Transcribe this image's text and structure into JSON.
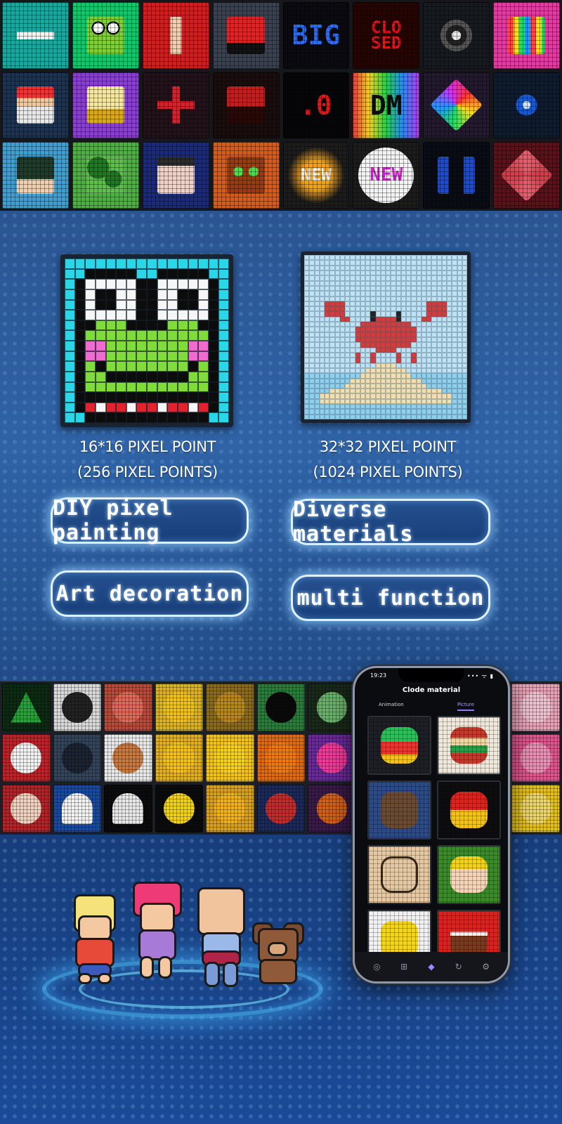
{
  "top_tiles": [
    {
      "icon": "airplane-icon",
      "bg": "#1aa7a0"
    },
    {
      "icon": "frog-face-icon",
      "bg": "#12c76a"
    },
    {
      "icon": "red-figure-icon",
      "bg": "#d01f1f"
    },
    {
      "icon": "red-bus-icon",
      "bg": "#3a4150"
    },
    {
      "icon": "big-text-icon",
      "bg": "#0a0a10",
      "text": "BIG",
      "color": "#2f6df0"
    },
    {
      "icon": "closed-text-icon",
      "bg": "#260404",
      "text": "CLO SED",
      "color": "#e0191c"
    },
    {
      "icon": "record-disc-icon",
      "bg": "#171a20"
    },
    {
      "icon": "rainbow-pattern-icon",
      "bg": "#e43aa3"
    },
    {
      "icon": "cashier-icon",
      "bg": "#1d3352"
    },
    {
      "icon": "trophy-cup-icon",
      "bg": "#8a3fd0"
    },
    {
      "icon": "red-cross-pattern-icon",
      "bg": "#23121a"
    },
    {
      "icon": "game-console-icon",
      "bg": "#1a0d0d"
    },
    {
      "icon": "zero-text-icon",
      "bg": "#060608",
      "text": ".0",
      "color": "#e01a1a"
    },
    {
      "icon": "dm-text-icon",
      "bg": "#1d1d22",
      "text": "DM",
      "color": "#0d0d0d"
    },
    {
      "icon": "rainbow-diamond-icon",
      "bg": "#241a2f"
    },
    {
      "icon": "blue-square-pattern-icon",
      "bg": "#0f1b2e"
    },
    {
      "icon": "classroom-icon",
      "bg": "#3e9fd3"
    },
    {
      "icon": "forest-icon",
      "bg": "#4cb140"
    },
    {
      "icon": "face-portrait-icon",
      "bg": "#1b2a7a"
    },
    {
      "icon": "robot-face-icon",
      "bg": "#d75b1a"
    },
    {
      "icon": "new-burst-icon",
      "bg": "#1c1c1c",
      "text": "NEW",
      "color": "#f3f3f3"
    },
    {
      "icon": "new-circle-icon",
      "bg": "#1c1c1c",
      "text": "NEW",
      "color": "#d21ecf"
    },
    {
      "icon": "blue-shapes-icon",
      "bg": "#090c14"
    },
    {
      "icon": "red-diamond-icon",
      "bg": "#5c1018"
    }
  ],
  "specs": {
    "small_line1": "16*16 PIXEL POINT",
    "small_line2": "(256 PIXEL POINTS)",
    "large_line1": "32*32 PIXEL POINT",
    "large_line2": "(1024 PIXEL POINTS)"
  },
  "features": {
    "diy": "DIY pixel painting",
    "diverse": "Diverse materials",
    "art": "Art decoration",
    "multi": "multi function"
  },
  "strip_tiles": [
    {
      "icon": "christmas-tree-icon",
      "bg": "#0d2a12"
    },
    {
      "icon": "cat-icon",
      "bg": "#d9d9d9"
    },
    {
      "icon": "red-monster-icon",
      "bg": "#b84a3c"
    },
    {
      "icon": "smiley-face-icon",
      "bg": "#d9b325"
    },
    {
      "icon": "cookie-face-icon",
      "bg": "#8a6b1e"
    },
    {
      "icon": "green-cat-face-icon",
      "bg": "#2b7c3a"
    },
    {
      "icon": "skull-icon",
      "bg": "#1a2a1a"
    },
    {
      "icon": "santa-icon",
      "bg": "#c0222a"
    },
    {
      "icon": "dark-figure-icon",
      "bg": "#34445a"
    },
    {
      "icon": "boy-icon",
      "bg": "#e9e9e9"
    },
    {
      "icon": "heart-eyes-emoji-icon",
      "bg": "#e0b020"
    },
    {
      "icon": "laughing-emoji-icon",
      "bg": "#f2c319"
    },
    {
      "icon": "pumpkin-icon",
      "bg": "#e06a10"
    },
    {
      "icon": "rainbow-skull-icon",
      "bg": "#6a2a9a"
    },
    {
      "icon": "santa-claus-icon",
      "bg": "#b3242a"
    },
    {
      "icon": "ghost-icon",
      "bg": "#1a4aa0"
    },
    {
      "icon": "small-ghost-icon",
      "bg": "#0b0b0d"
    },
    {
      "icon": "tiny-smiley-icon",
      "bg": "#0b0b0d"
    },
    {
      "icon": "smiling-sun-icon",
      "bg": "#d8a020"
    },
    {
      "icon": "wizard-icon",
      "bg": "#1c2a5a"
    },
    {
      "icon": "small-pumpkin-icon",
      "bg": "#3a1a48"
    }
  ],
  "strip_right_tiles": [
    {
      "icon": "pink-bear-icon",
      "bg": "#e7a2b8"
    },
    {
      "icon": "pink-face-icon",
      "bg": "#e0558e"
    },
    {
      "icon": "yellow-face-icon",
      "bg": "#e3c01c"
    }
  ],
  "phone": {
    "time": "19:23",
    "signal": "••• ᯤ ▮",
    "title": "Clode material",
    "tab_animation": "Animation",
    "tab_picture": "Picture",
    "gallery": [
      {
        "icon": "parrot-icon",
        "bg": "#1e1f25"
      },
      {
        "icon": "ornament-ball-icon",
        "bg": "#f0e8da"
      },
      {
        "icon": "cat-face-icon",
        "bg": "#2c4a86"
      },
      {
        "icon": "iron-man-icon",
        "bg": "#0d0d10"
      },
      {
        "icon": "gingerbread-outline-icon",
        "bg": "#e6c9a3"
      },
      {
        "icon": "elf-face-icon",
        "bg": "#3a8a2a"
      },
      {
        "icon": "yellow-duck-icon",
        "bg": "#f2f2f2"
      },
      {
        "icon": "red-house-icon",
        "bg": "#d8231e"
      }
    ],
    "nav": [
      "compass-icon",
      "grid-icon",
      "paint-icon",
      "refresh-icon",
      "settings-icon"
    ]
  }
}
